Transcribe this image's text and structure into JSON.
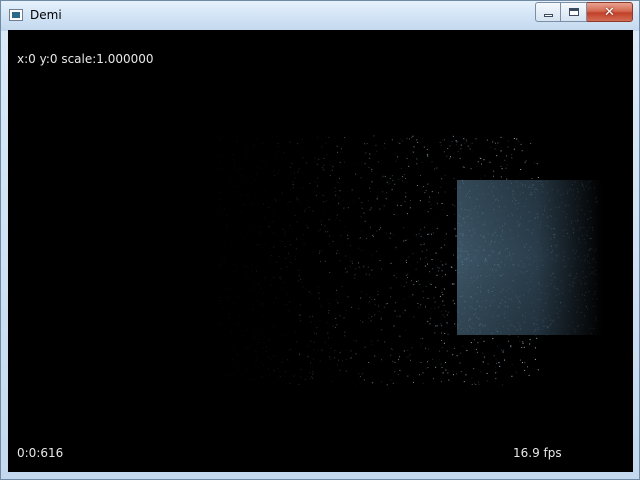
{
  "window": {
    "title": "Demi",
    "close_glyph": "✕"
  },
  "hud": {
    "coords": "x:0 y:0 scale:1.000000",
    "time": "0:0:616",
    "fps": "16.9 fps"
  },
  "colors": {
    "background": "#000000",
    "particle": "#a9c4d6",
    "block": "#2b3f4e"
  },
  "icons": [
    "app-icon",
    "minimize-icon",
    "maximize-icon",
    "close-icon"
  ]
}
